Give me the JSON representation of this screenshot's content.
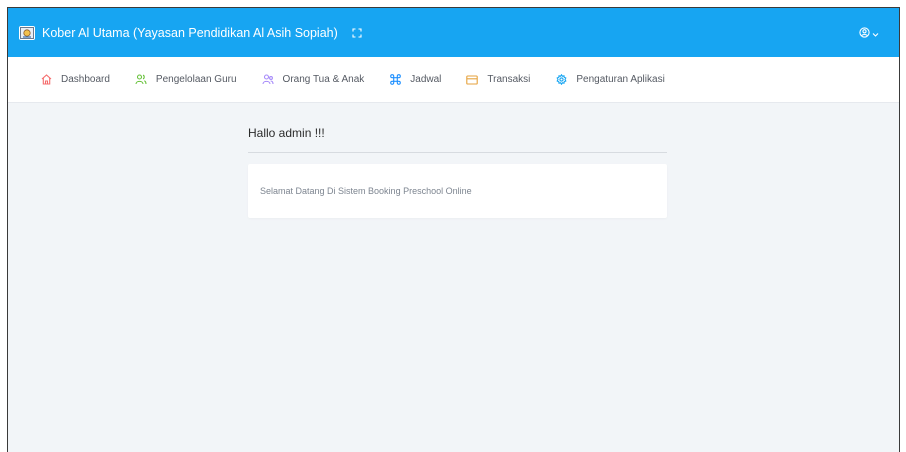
{
  "header": {
    "title": "Kober Al Utama (Yayasan Pendidikan Al Asih Sopiah)",
    "logo_icon": "school-logo",
    "fullscreen_icon": "fullscreen-icon",
    "user_icon": "user-circle-icon",
    "background_color": "#17a5f2"
  },
  "nav": {
    "items": [
      {
        "label": "Dashboard",
        "icon": "home-icon",
        "icon_color": "#f56c6c"
      },
      {
        "label": "Pengelolaan Guru",
        "icon": "users-icon",
        "icon_color": "#67c23a"
      },
      {
        "label": "Orang Tua & Anak",
        "icon": "user-group-icon",
        "icon_color": "#a78bfa"
      },
      {
        "label": "Jadwal",
        "icon": "command-icon",
        "icon_color": "#1e90ff"
      },
      {
        "label": "Transaksi",
        "icon": "card-icon",
        "icon_color": "#e6a23c"
      },
      {
        "label": "Pengaturan Aplikasi",
        "icon": "gear-icon",
        "icon_color": "#17a5f2"
      }
    ]
  },
  "main": {
    "greeting": "Hallo admin !!!",
    "welcome_message": "Selamat Datang Di Sistem Booking Preschool Online"
  }
}
